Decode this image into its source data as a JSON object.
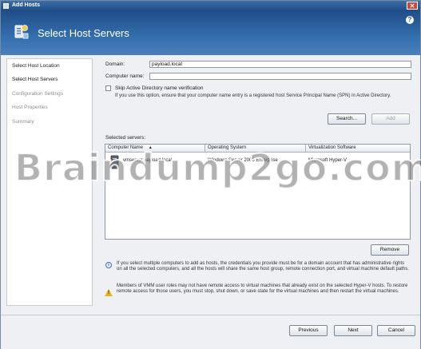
{
  "window": {
    "title": "Add Hosts"
  },
  "header": {
    "title": "Select Host Servers"
  },
  "sidebar": {
    "items": [
      {
        "label": "Select Host Location",
        "state": "done"
      },
      {
        "label": "Select Host Servers",
        "state": "active"
      },
      {
        "label": "Configuration Settings",
        "state": "pending"
      },
      {
        "label": "Host Properties",
        "state": "pending"
      },
      {
        "label": "Summary",
        "state": "pending"
      }
    ]
  },
  "form": {
    "domain_label": "Domain:",
    "domain_value": "payload.local",
    "computer_name_label": "Computer name:",
    "computer_name_value": "",
    "skip_ad_label": "Skip Active Directory name verification",
    "skip_ad_hint": "If you use this option, ensure that your computer name entry is a registered host Service Principal Name (SPN) in Active Directory.",
    "search_button": "Search...",
    "add_button": "Add"
  },
  "servers": {
    "label": "Selected servers:",
    "columns": [
      "Computer Name",
      "Operating System",
      "Virtualization Software"
    ],
    "rows": [
      {
        "name": "vmserver.payload.local",
        "os": "Windows Server 2008 Enterprise",
        "virt": "Microsoft Hyper-V"
      }
    ],
    "remove_button": "Remove"
  },
  "notes": {
    "info": "If you select multiple computers to add as hosts, the credentials you provide must be for a domain account that has administrative rights on all the selected computers, and all the hosts will share the same host group, remote connection port, and virtual machine default paths.",
    "warning": "Members of VMM user roles may not have remote access to virtual machines that already exist on the selected Hyper-V hosts. To restore remote access for those users, you must stop, shut down, or save state for the virtual machines and then restart the virtual machines."
  },
  "footer": {
    "previous": "Previous",
    "next": "Next",
    "cancel": "Cancel"
  },
  "watermark": "Braindump2go.com",
  "colors": {
    "header": "#2a5d9b",
    "accent": "#3b6fb4",
    "warning": "#e8b31a"
  }
}
